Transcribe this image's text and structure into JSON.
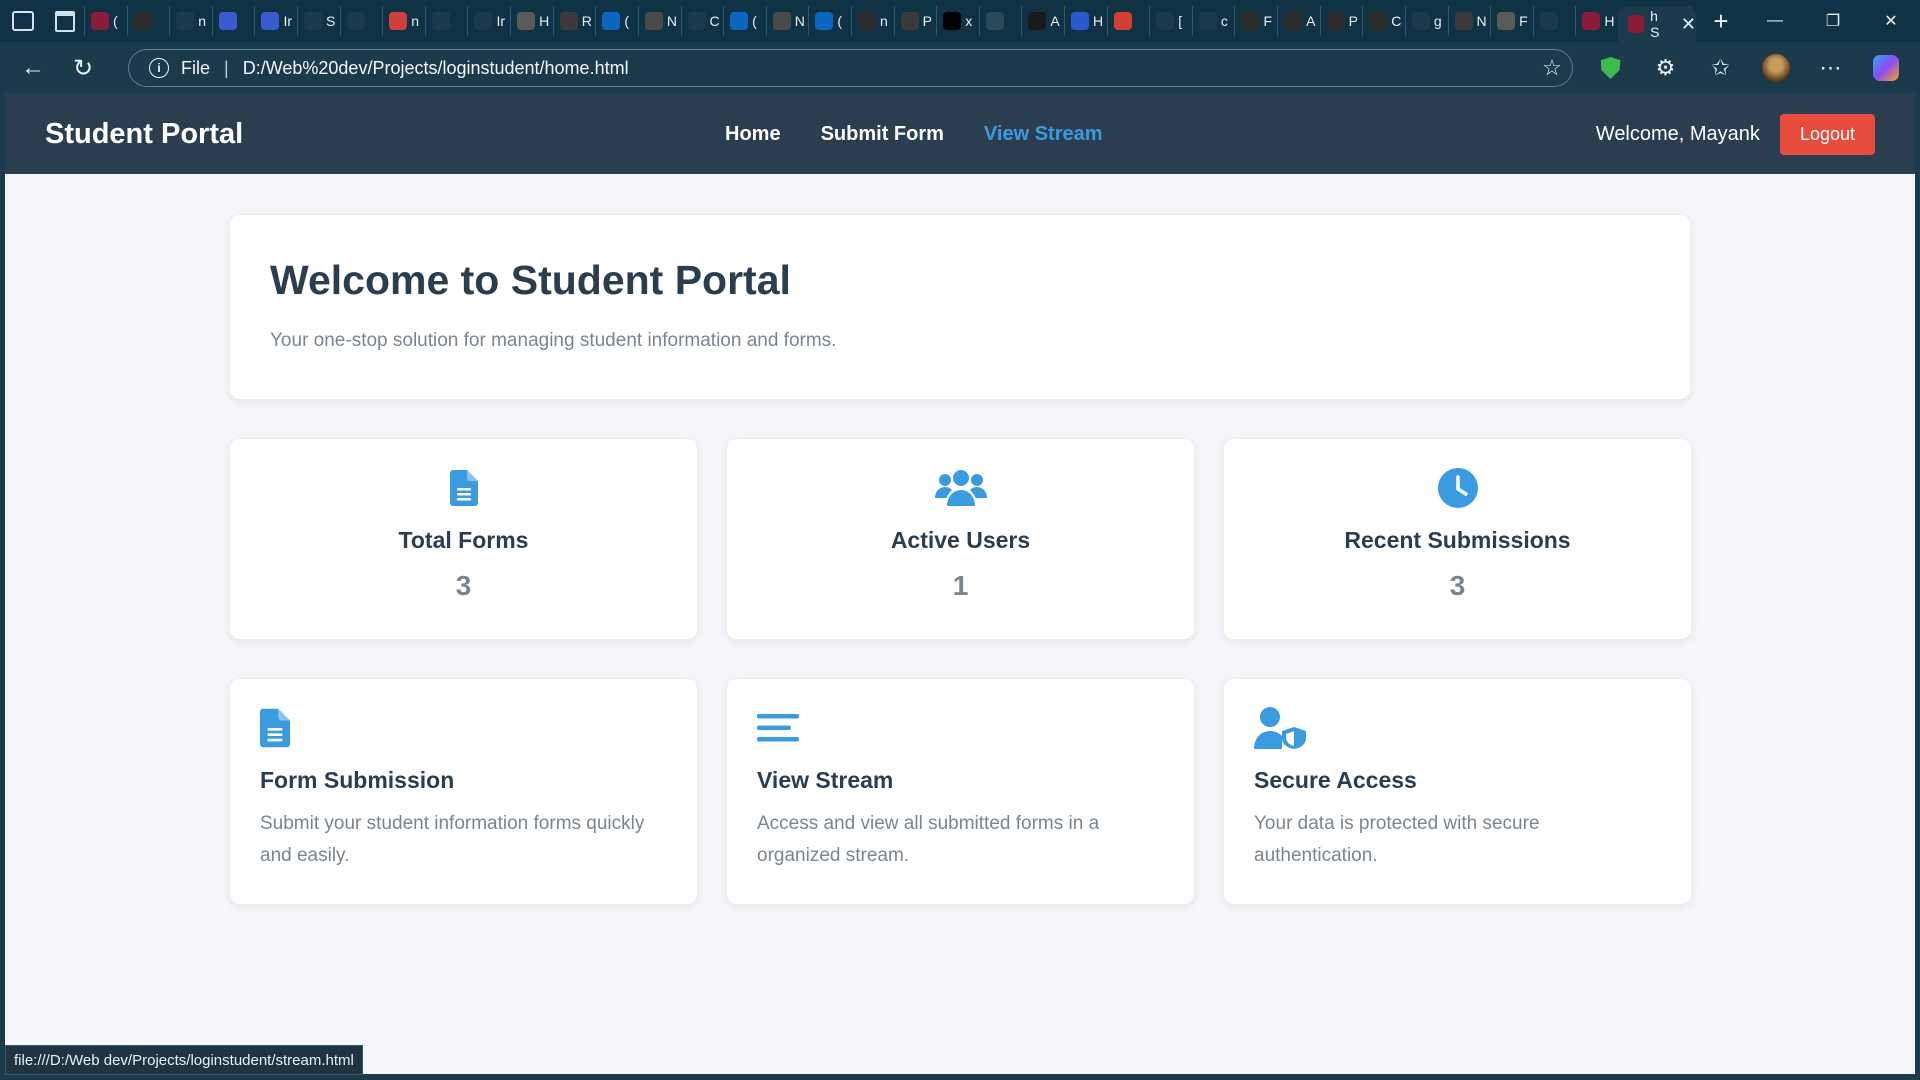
{
  "browser": {
    "tab_chars": [
      "(",
      "",
      "n",
      "",
      "Ir",
      "S",
      "",
      "n",
      "",
      "Ir",
      "H",
      "R",
      "(",
      "N",
      "C",
      "(",
      "N",
      "(",
      "n",
      "P",
      "x",
      "",
      "A",
      "H",
      "",
      "[",
      "c",
      "F",
      "A",
      "P",
      "C",
      "g",
      "N",
      "F",
      "",
      "H"
    ],
    "tab_colors": [
      "#8a1c3a",
      "#2b2b2b",
      "#1b3a4b",
      "#3a5bd0",
      "#3a5bd0",
      "#1b3a4b",
      "#1b3a4b",
      "#d04040",
      "#1b3a4b",
      "#1b3a4b",
      "#5a5a5a",
      "#3a3a3a",
      "#0a66c2",
      "#4a4a4a",
      "#1b3a4b",
      "#0a66c2",
      "#4a4a4a",
      "#0a66c2",
      "#2b2b2b",
      "#3a3a3a",
      "#000000",
      "#2a4a5a",
      "#1a1a1a",
      "#2a5ad0",
      "#d04030",
      "#1b3a4b",
      "#1b3a4b",
      "#2b2b2b",
      "#2b2b2b",
      "#2b2b2b",
      "#2b2b2b",
      "#1b3a4b",
      "#3a3a3a",
      "#5a5a5a",
      "#1b3a4b",
      "#8a1c3a"
    ],
    "active_tab_char": "h S",
    "address_label": "File",
    "url": "D:/Web%20dev/Projects/loginstudent/home.html",
    "status_url": "file:///D:/Web dev/Projects/loginstudent/stream.html"
  },
  "navbar": {
    "brand": "Student Portal",
    "links": [
      {
        "label": "Home",
        "active": false
      },
      {
        "label": "Submit Form",
        "active": false
      },
      {
        "label": "View Stream",
        "active": true
      }
    ],
    "welcome": "Welcome, Mayank",
    "logout": "Logout"
  },
  "hero": {
    "title": "Welcome to Student Portal",
    "subtitle": "Your one-stop solution for managing student information and forms."
  },
  "stats": [
    {
      "icon": "file-icon",
      "title": "Total Forms",
      "value": "3"
    },
    {
      "icon": "users-icon",
      "title": "Active Users",
      "value": "1"
    },
    {
      "icon": "clock-icon",
      "title": "Recent Submissions",
      "value": "3"
    }
  ],
  "features": [
    {
      "icon": "file-icon",
      "title": "Form Submission",
      "desc": "Submit your student information forms quickly and easily."
    },
    {
      "icon": "stream-icon",
      "title": "View Stream",
      "desc": "Access and view all submitted forms in a organized stream."
    },
    {
      "icon": "user-shield-icon",
      "title": "Secure Access",
      "desc": "Your data is protected with secure authentication."
    }
  ],
  "colors": {
    "accent": "#3b9be0",
    "navbar": "#2b3e50",
    "logout": "#e74c3c",
    "muted_text": "#7b8590"
  }
}
